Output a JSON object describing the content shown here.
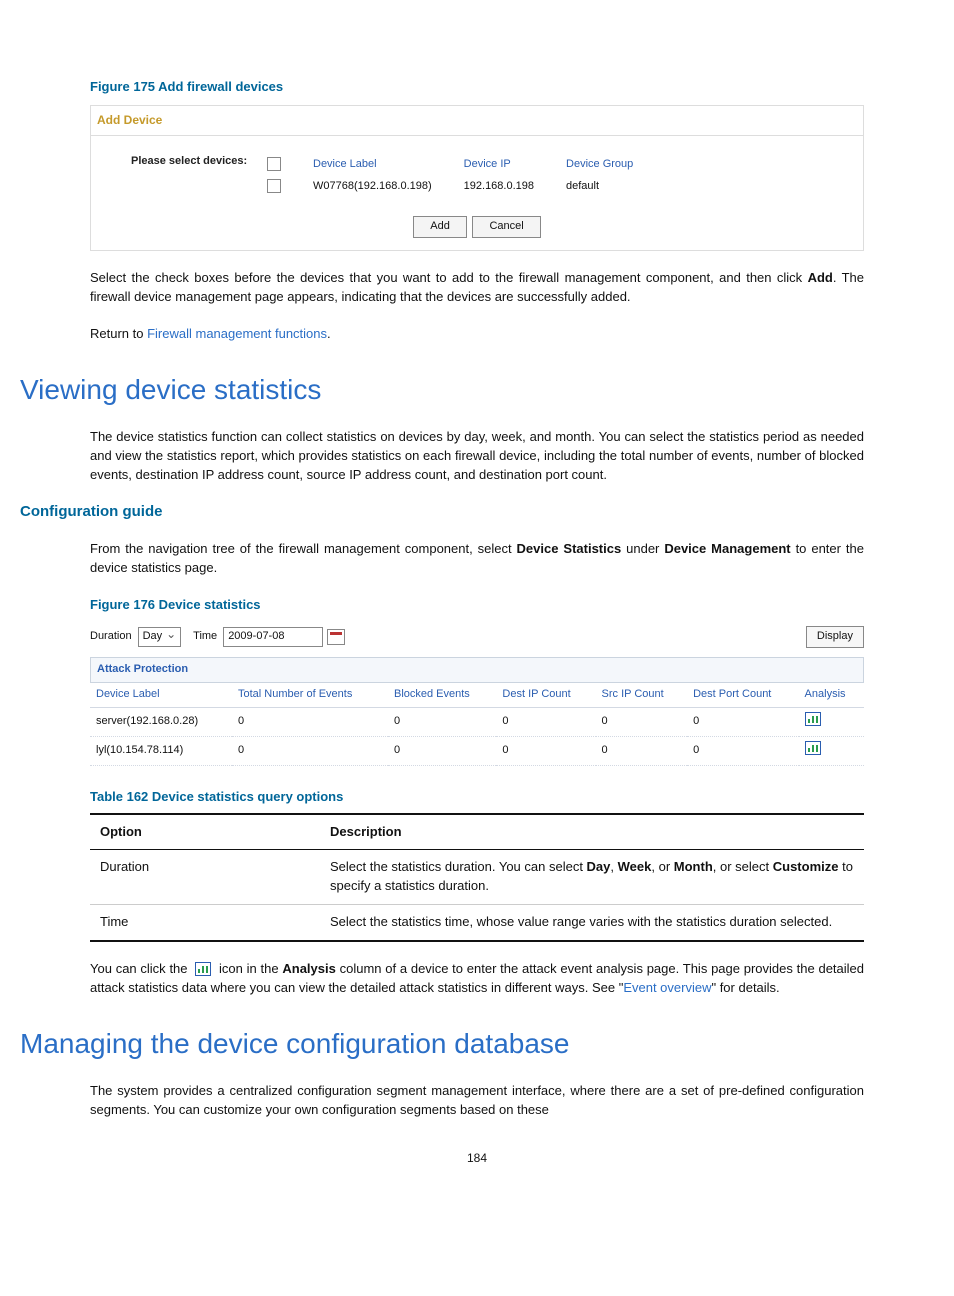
{
  "figure175": {
    "caption": "Figure 175 Add firewall devices",
    "panel_title": "Add Device",
    "prompt": "Please select devices:",
    "headers": {
      "label": "Device Label",
      "ip": "Device IP",
      "group": "Device Group"
    },
    "row": {
      "label": "W07768(192.168.0.198)",
      "ip": "192.168.0.198",
      "group": "default"
    },
    "add_btn": "Add",
    "cancel_btn": "Cancel"
  },
  "para_select_add": {
    "p1a": "Select the check boxes before the devices that you want to add to the firewall management component, and then click ",
    "p1b": ". The firewall device management page appears, indicating that the devices are successfully added.",
    "p2a": "Return to ",
    "p2link": "Firewall management functions",
    "p2b": "."
  },
  "section_stats": {
    "heading": "Viewing device statistics",
    "intro": "The device statistics function can collect statistics on devices by day, week, and month. You can select the statistics period as needed and view the statistics report, which provides statistics on each firewall device, including the total number of events, number of blocked events, destination IP address count, source IP address count, and destination port count."
  },
  "config_guide": {
    "heading": "Configuration guide",
    "text_a": "From the navigation tree of the firewall management component, select ",
    "bold1": "Device Statistics",
    "text_b": " under ",
    "bold2": "Device Management",
    "text_c": " to enter the device statistics page."
  },
  "figure176": {
    "caption": "Figure 176 Device statistics",
    "duration_lbl": "Duration",
    "duration_val": "Day",
    "time_lbl": "Time",
    "time_val": "2009-07-08",
    "display_btn": "Display",
    "attack_heading": "Attack Protection",
    "cols": {
      "device": "Device Label",
      "total": "Total Number of Events",
      "blocked": "Blocked Events",
      "destip": "Dest IP Count",
      "srcip": "Src IP Count",
      "destport": "Dest Port Count",
      "analysis": "Analysis"
    },
    "rows": [
      {
        "device": "server(192.168.0.28)",
        "total": "0",
        "blocked": "0",
        "destip": "0",
        "srcip": "0",
        "destport": "0"
      },
      {
        "device": "lyl(10.154.78.114)",
        "total": "0",
        "blocked": "0",
        "destip": "0",
        "srcip": "0",
        "destport": "0"
      }
    ]
  },
  "table162": {
    "caption": "Table 162 Device statistics query options",
    "col_option": "Option",
    "col_desc": "Description",
    "rows": [
      {
        "option": "Duration",
        "d1": "Select the statistics duration. You can select ",
        "b1": "Day",
        "d2": ", ",
        "b2": "Week",
        "d3": ", or ",
        "b3": "Month",
        "d4": ", or select ",
        "b4": "Customize",
        "d5": " to specify a statistics duration."
      },
      {
        "option": "Time",
        "desc": "Select the statistics time, whose value range varies with the statistics duration selected."
      }
    ]
  },
  "after_table": {
    "a": "You can click the ",
    "b": " icon in the ",
    "bold1": "Analysis",
    "c": " column of a device to enter the attack event analysis page. This page provides the detailed attack statistics data where you can view the detailed attack statistics in different ways. See \"",
    "link": "Event overview",
    "d": "\" for details."
  },
  "section_db": {
    "heading": "Managing the device configuration database",
    "text": "The system provides a centralized configuration segment management interface, where there are a set of pre-defined configuration segments. You can customize your own configuration segments based on these"
  },
  "page_number": "184"
}
